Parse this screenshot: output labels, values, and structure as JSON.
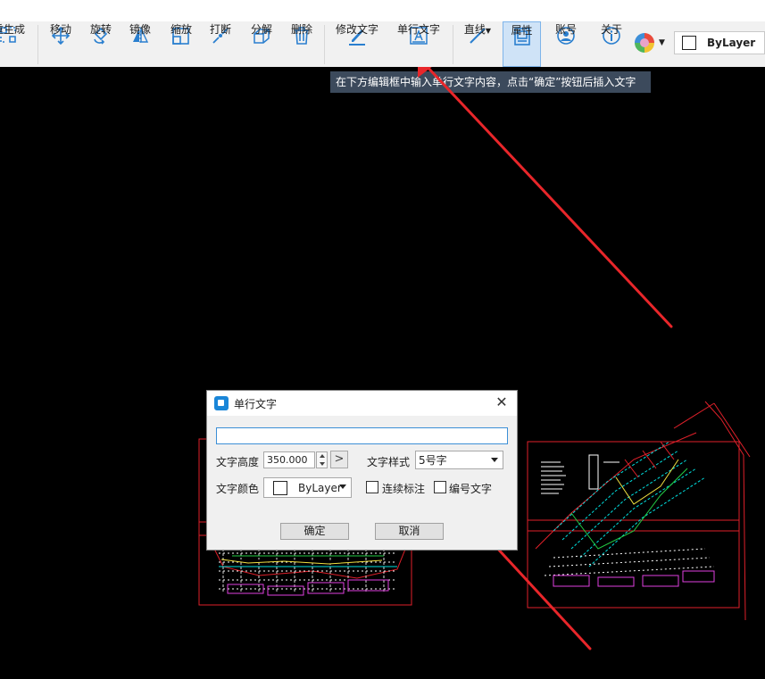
{
  "toolbar": {
    "tools": [
      {
        "label": "重生成",
        "icon": "regenerate-icon"
      },
      {
        "label": "移动",
        "icon": "move-icon"
      },
      {
        "label": "旋转",
        "icon": "rotate-icon"
      },
      {
        "label": "镜像",
        "icon": "mirror-icon"
      },
      {
        "label": "缩放",
        "icon": "scale-icon"
      },
      {
        "label": "打断",
        "icon": "break-icon"
      },
      {
        "label": "分解",
        "icon": "explode-icon"
      },
      {
        "label": "删除",
        "icon": "delete-icon"
      },
      {
        "label": "修改文字",
        "icon": "edit-text-icon"
      },
      {
        "label": "单行文字",
        "icon": "single-line-text-icon"
      },
      {
        "label": "直线",
        "icon": "line-icon"
      },
      {
        "label": "属性",
        "icon": "properties-icon"
      },
      {
        "label": "账号",
        "icon": "account-icon"
      },
      {
        "label": "关于",
        "icon": "about-icon"
      }
    ],
    "layer": "ByLayer"
  },
  "tooltip": "在下方编辑框中输入单行文字内容，点击“确定”按钮后插入文字",
  "dialog": {
    "title": "单行文字",
    "text_value": "",
    "height_label": "文字高度",
    "height_value": "350.000",
    "style_label": "文字样式",
    "style_value": "5号字",
    "color_label": "文字颜色",
    "color_value": "ByLayer",
    "continuous_label": "连续标注",
    "numbered_label": "编号文字",
    "ok_label": "确定",
    "cancel_label": "取消"
  },
  "colors": {
    "annotation": "#e8262a",
    "drawing_red": "#e0202a"
  }
}
